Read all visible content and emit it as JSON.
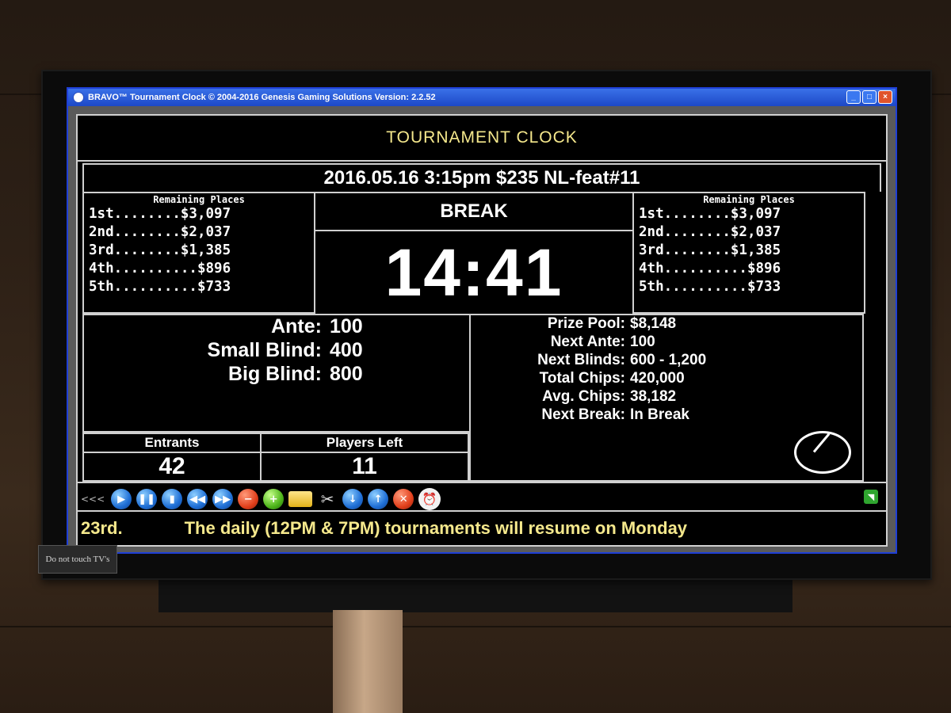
{
  "window": {
    "title": "BRAVO™ Tournament Clock © 2004-2016 Genesis Gaming Solutions  Version: 2.2.52"
  },
  "header": {
    "title": "TOURNAMENT CLOCK"
  },
  "event": {
    "name": "2016.05.16  3:15pm $235 NL-feat#11"
  },
  "places_left": {
    "heading": "Remaining Places",
    "rows": [
      "1st........$3,097",
      "2nd........$2,037",
      "3rd........$1,385",
      "4th..........$896",
      "5th..........$733"
    ]
  },
  "places_right": {
    "heading": "Remaining Places",
    "rows": [
      "1st........$3,097",
      "2nd........$2,037",
      "3rd........$1,385",
      "4th..........$896",
      "5th..........$733"
    ]
  },
  "level": {
    "label": "BREAK"
  },
  "timer": {
    "value": "14:41"
  },
  "blinds": {
    "ante_label": "Ante:",
    "ante": "100",
    "sb_label": "Small Blind:",
    "sb": "400",
    "bb_label": "Big Blind:",
    "bb": "800"
  },
  "counts": {
    "entrants_label": "Entrants",
    "entrants": "42",
    "players_left_label": "Players Left",
    "players_left": "11"
  },
  "stats": {
    "prize_pool_label": "Prize Pool:",
    "prize_pool": "$8,148",
    "next_ante_label": "Next Ante:",
    "next_ante": "100",
    "next_blinds_label": "Next Blinds:",
    "next_blinds": "600 - 1,200",
    "total_chips_label": "Total Chips:",
    "total_chips": "420,000",
    "avg_chips_label": "Avg. Chips:",
    "avg_chips": "38,182",
    "next_break_label": "Next Break:",
    "next_break": "In Break"
  },
  "toolbar": {
    "arrows": "<<<"
  },
  "ticker": {
    "left": "23rd.",
    "message": "The daily (12PM & 7PM) tournaments will resume on Monday"
  },
  "sign": {
    "text": "Do not touch TV's"
  },
  "colors": {
    "title_yellow": "#f5e88c",
    "titlebar_blue": "#1c48c7",
    "accent_blue": "#1f3fd6"
  }
}
